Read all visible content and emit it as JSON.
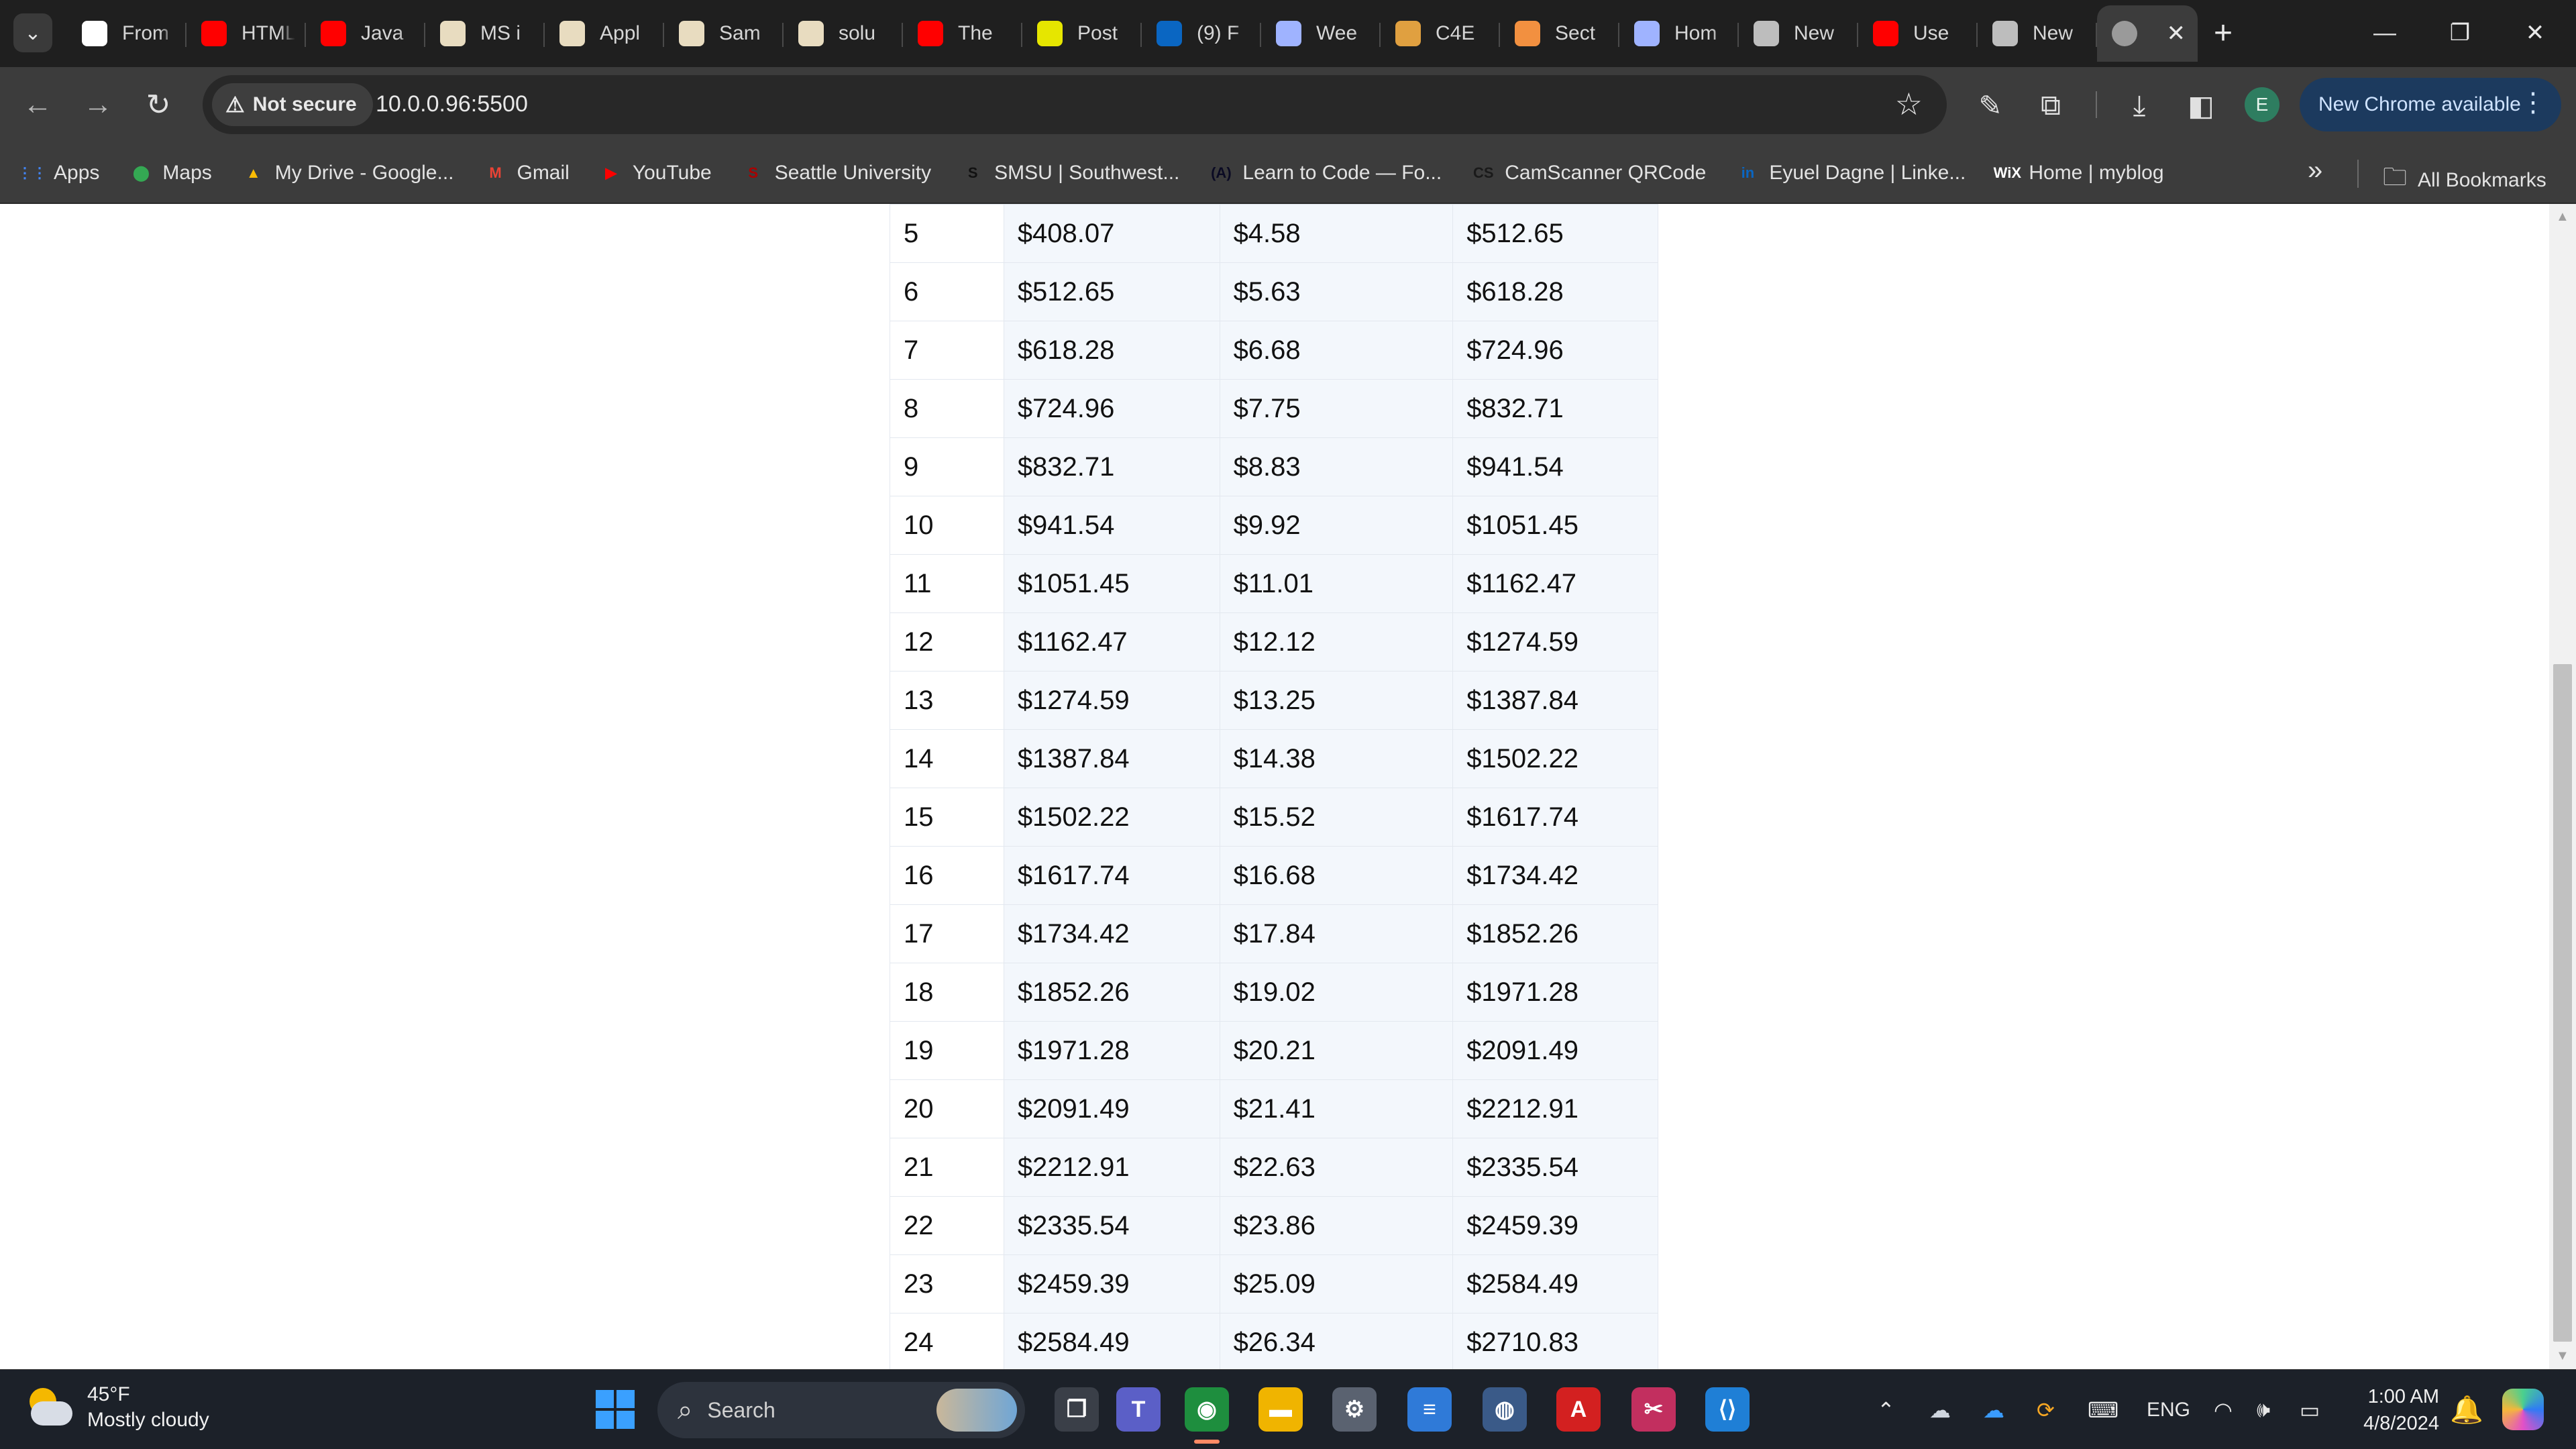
{
  "browser": {
    "tabs": [
      {
        "label": "From",
        "icon": "r-logo-icon",
        "color": "#ffffff"
      },
      {
        "label": "HTML",
        "icon": "youtube-icon",
        "color": "#ff0000"
      },
      {
        "label": "Java",
        "icon": "youtube-icon",
        "color": "#ff0000"
      },
      {
        "label": "MS i",
        "icon": "seattleu-icon",
        "color": "#e8dcc0"
      },
      {
        "label": "Appl",
        "icon": "seattleu-icon",
        "color": "#e8dcc0"
      },
      {
        "label": "Sam",
        "icon": "seattleu-icon",
        "color": "#e8dcc0"
      },
      {
        "label": "solu",
        "icon": "seattleu-icon",
        "color": "#e8dcc0"
      },
      {
        "label": "The",
        "icon": "youtube-icon",
        "color": "#ff0000"
      },
      {
        "label": "Post",
        "icon": "h-logo-icon",
        "color": "#e6e600"
      },
      {
        "label": "(9) F",
        "icon": "linkedin-icon",
        "color": "#0a66c2"
      },
      {
        "label": "Wee",
        "icon": "hourglass-icon",
        "color": "#9fb3ff"
      },
      {
        "label": "C4E",
        "icon": "c4e-icon",
        "color": "#e0a040"
      },
      {
        "label": "Sect",
        "icon": "zybooks-icon",
        "color": "#f29040"
      },
      {
        "label": "Hom",
        "icon": "hourglass-icon",
        "color": "#9fb3ff"
      },
      {
        "label": "New",
        "icon": "chrome-icon",
        "color": "#bdbdbd"
      },
      {
        "label": "Use",
        "icon": "youtube-icon",
        "color": "#ff0000"
      },
      {
        "label": "New",
        "icon": "chrome-icon",
        "color": "#bdbdbd"
      }
    ],
    "active_tab": {
      "icon": "globe-icon",
      "close": "✕"
    },
    "new_tab": "+",
    "window_controls": {
      "minimize": "—",
      "restore": "❐",
      "close": "✕"
    },
    "security": "Not secure",
    "url": "10.0.0.96:5500",
    "update_button": "New Chrome available",
    "avatar_letter": "E"
  },
  "bookmarks": {
    "items": [
      {
        "label": "Apps",
        "icon": "apps-grid-icon",
        "glyph": "⋮⋮",
        "color": "#4285f4"
      },
      {
        "label": "Maps",
        "icon": "maps-pin-icon",
        "glyph": "⬤",
        "color": "#34a853"
      },
      {
        "label": "My Drive - Google...",
        "icon": "google-drive-icon",
        "glyph": "▲",
        "color": "#fbbc04"
      },
      {
        "label": "Gmail",
        "icon": "gmail-icon",
        "glyph": "M",
        "color": "#ea4335"
      },
      {
        "label": "YouTube",
        "icon": "youtube-icon",
        "glyph": "▶",
        "color": "#ff0000"
      },
      {
        "label": "Seattle University",
        "icon": "seattleu-icon",
        "glyph": "S",
        "color": "#aa0000"
      },
      {
        "label": "SMSU | Southwest...",
        "icon": "smsu-icon",
        "glyph": "S",
        "color": "#111111"
      },
      {
        "label": "Learn to Code — Fo...",
        "icon": "freecodecamp-icon",
        "glyph": "(A)",
        "color": "#0a0a23"
      },
      {
        "label": "CamScanner QRCode",
        "icon": "camscanner-icon",
        "glyph": "CS",
        "color": "#1a1a1a"
      },
      {
        "label": "Eyuel Dagne | Linke...",
        "icon": "linkedin-icon",
        "glyph": "in",
        "color": "#0a66c2"
      },
      {
        "label": "Home | myblog",
        "icon": "wix-icon",
        "glyph": "WiX",
        "color": "#ffffff"
      }
    ],
    "more": "»",
    "all_bookmarks": "All Bookmarks"
  },
  "table": {
    "rows": [
      [
        "5",
        "$408.07",
        "$4.58",
        "$512.65"
      ],
      [
        "6",
        "$512.65",
        "$5.63",
        "$618.28"
      ],
      [
        "7",
        "$618.28",
        "$6.68",
        "$724.96"
      ],
      [
        "8",
        "$724.96",
        "$7.75",
        "$832.71"
      ],
      [
        "9",
        "$832.71",
        "$8.83",
        "$941.54"
      ],
      [
        "10",
        "$941.54",
        "$9.92",
        "$1051.45"
      ],
      [
        "11",
        "$1051.45",
        "$11.01",
        "$1162.47"
      ],
      [
        "12",
        "$1162.47",
        "$12.12",
        "$1274.59"
      ],
      [
        "13",
        "$1274.59",
        "$13.25",
        "$1387.84"
      ],
      [
        "14",
        "$1387.84",
        "$14.38",
        "$1502.22"
      ],
      [
        "15",
        "$1502.22",
        "$15.52",
        "$1617.74"
      ],
      [
        "16",
        "$1617.74",
        "$16.68",
        "$1734.42"
      ],
      [
        "17",
        "$1734.42",
        "$17.84",
        "$1852.26"
      ],
      [
        "18",
        "$1852.26",
        "$19.02",
        "$1971.28"
      ],
      [
        "19",
        "$1971.28",
        "$20.21",
        "$2091.49"
      ],
      [
        "20",
        "$2091.49",
        "$21.41",
        "$2212.91"
      ],
      [
        "21",
        "$2212.91",
        "$22.63",
        "$2335.54"
      ],
      [
        "22",
        "$2335.54",
        "$23.86",
        "$2459.39"
      ],
      [
        "23",
        "$2459.39",
        "$25.09",
        "$2584.49"
      ],
      [
        "24",
        "$2584.49",
        "$26.34",
        "$2710.83"
      ]
    ]
  },
  "taskbar": {
    "weather_temp": "45°F",
    "weather_desc": "Mostly cloudy",
    "search_placeholder": "Search",
    "language": "ENG",
    "time": "1:00 AM",
    "date": "4/8/2024",
    "apps": [
      {
        "name": "task-view",
        "glyph": "❐",
        "color": "#3a3f48"
      },
      {
        "name": "teams",
        "glyph": "T",
        "color": "#5b5fc7"
      },
      {
        "name": "chrome",
        "glyph": "◉",
        "color": "#1e8e3e"
      },
      {
        "name": "file-explorer",
        "glyph": "▬",
        "color": "#f0b400"
      },
      {
        "name": "settings",
        "glyph": "⚙",
        "color": "#5a6270"
      },
      {
        "name": "notepad",
        "glyph": "≡",
        "color": "#2f7ad8"
      },
      {
        "name": "network-globe",
        "glyph": "◍",
        "color": "#3a5a88"
      },
      {
        "name": "acrobat",
        "glyph": "A",
        "color": "#d32020"
      },
      {
        "name": "snipping-tool",
        "glyph": "✂",
        "color": "#c22f5f"
      },
      {
        "name": "vscode",
        "glyph": "⟨⟩",
        "color": "#1f7fd6"
      }
    ]
  }
}
